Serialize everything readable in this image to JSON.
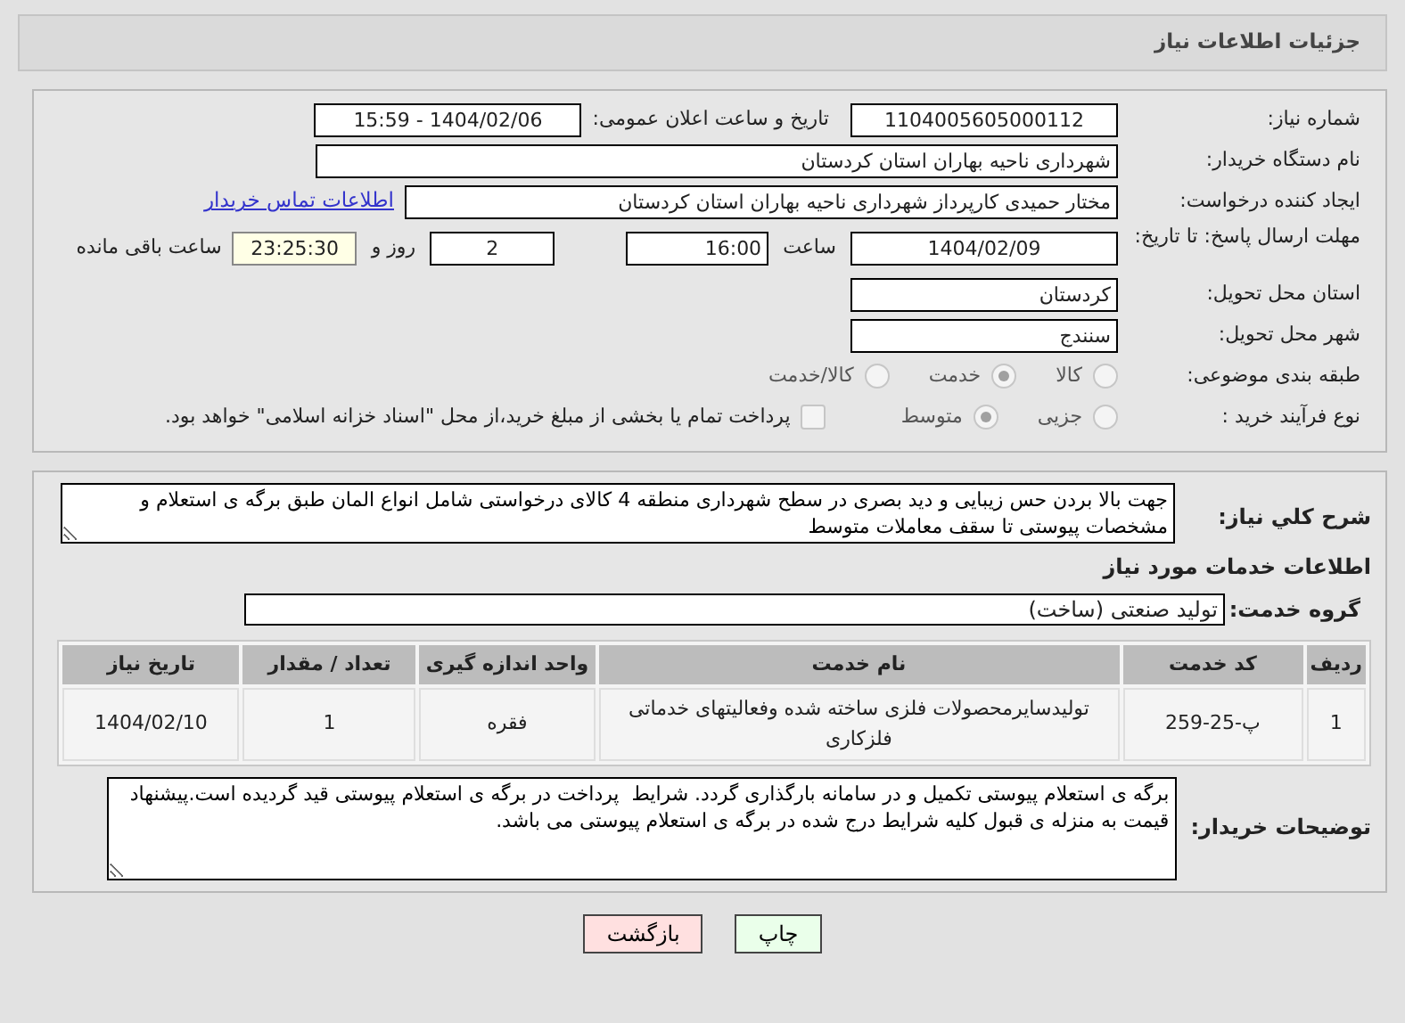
{
  "header": {
    "title": "جزئیات اطلاعات نیاز"
  },
  "need_number": {
    "label": "شماره نیاز:",
    "value": "1104005605000112"
  },
  "announce": {
    "label": "تاریخ و ساعت اعلان عمومی:",
    "value": "1404/02/06 - 15:59"
  },
  "buyer_org": {
    "label": "نام دستگاه خریدار:",
    "value": "شهرداری ناحیه بهاران استان کردستان"
  },
  "creator": {
    "label": "ایجاد کننده درخواست:",
    "value": "مختار حمیدی کارپرداز شهرداری ناحیه بهاران استان کردستان",
    "link": "اطلاعات تماس خریدار"
  },
  "deadline": {
    "label": "مهلت ارسال پاسخ: تا تاریخ:",
    "date": "1404/02/09",
    "time_label": "ساعت",
    "time": "16:00",
    "days": "2",
    "days_label": "روز و",
    "remaining": "23:25:30",
    "remaining_label": "ساعت باقی مانده"
  },
  "province": {
    "label": "استان محل تحویل:",
    "value": "کردستان"
  },
  "city": {
    "label": "شهر محل تحویل:",
    "value": "سنندج"
  },
  "category": {
    "label": "طبقه بندی موضوعی:",
    "options": [
      {
        "label": "کالا",
        "selected": false
      },
      {
        "label": "خدمت",
        "selected": true
      },
      {
        "label": "کالا/خدمت",
        "selected": false
      }
    ]
  },
  "process": {
    "label": "نوع فرآیند خرید :",
    "options": [
      {
        "label": "جزیی",
        "selected": false
      },
      {
        "label": "متوسط",
        "selected": true
      }
    ],
    "payment": {
      "label": "پرداخت تمام یا بخشی از مبلغ خرید،از محل \"اسناد خزانه اسلامی\" خواهد بود.",
      "checked": false
    }
  },
  "description": {
    "label": "شرح کلي نياز:",
    "value": "جهت بالا بردن حس زیبایی و دید بصری در سطح شهرداری منطقه 4 کالای درخواستی شامل انواع المان طبق برگه ی استعلام و مشخصات پیوستی تا سقف معاملات متوسط"
  },
  "services_heading": "اطلاعات خدمات مورد نیاز",
  "service_group": {
    "label": "گروه خدمت:",
    "value": "تولید صنعتی (ساخت)"
  },
  "table": {
    "columns": [
      "ردیف",
      "کد خدمت",
      "نام خدمت",
      "واحد اندازه گیری",
      "تعداد / مقدار",
      "تاریخ نیاز"
    ],
    "rows": [
      [
        "1",
        "پ-25-259",
        "تولیدسایرمحصولات فلزی ساخته شده وفعالیتهای خدماتی فلزکاری",
        "فقره",
        "1",
        "1404/02/10"
      ]
    ]
  },
  "buyer_notes": {
    "label": "توضیحات خریدار:",
    "value": "برگه ی استعلام پیوستی تکمیل و در سامانه بارگذاری گردد. شرایط  پرداخت در برگه ی استعلام پیوستی قید گردیده است.پیشنهاد قیمت به منزله ی قبول کلیه شرایط درج شده در برگه ی استعلام پیوستی می باشد."
  },
  "buttons": [
    {
      "label": "چاپ",
      "color": "#eaffea"
    },
    {
      "label": "بازگشت",
      "color": "#ffe0e0"
    }
  ]
}
